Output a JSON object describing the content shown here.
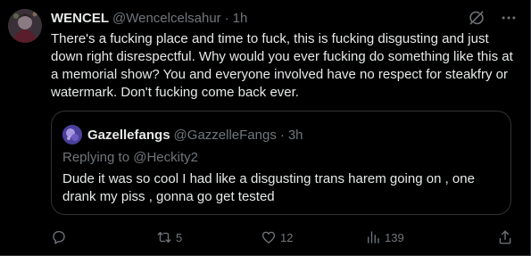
{
  "tweet": {
    "display_name": "WENCEL",
    "handle": "@Wencelcelsahur",
    "separator": "·",
    "time": "1h",
    "text": "There's a fucking place and time to fuck, this is fucking disgusting and just down right disrespectful. Why would you ever fucking do something like this at a memorial show? You and everyone involved have no respect for steakfry or watermark. Don't fucking come back ever."
  },
  "top_icons": [
    "grok-icon",
    "more-icon"
  ],
  "quote": {
    "display_name": "Gazellefangs",
    "handle": "@GazzelleFangs",
    "separator": "·",
    "time": "3h",
    "replying_to": "Replying to @Heckity2",
    "text": "Dude it was so cool I had like a disgusting trans harem going on , one drank my piss , gonna go get tested"
  },
  "actions": {
    "reply": {
      "icon": "reply-icon",
      "count": ""
    },
    "retweet": {
      "icon": "retweet-icon",
      "count": "5"
    },
    "like": {
      "icon": "heart-icon",
      "count": "12"
    },
    "views": {
      "icon": "views-icon",
      "count": "139"
    },
    "share": {
      "icon": "share-icon",
      "count": ""
    }
  },
  "colors": {
    "background": "#000000",
    "text_primary": "#e7e9ea",
    "text_secondary": "#71767b",
    "border": "#2f3336"
  }
}
